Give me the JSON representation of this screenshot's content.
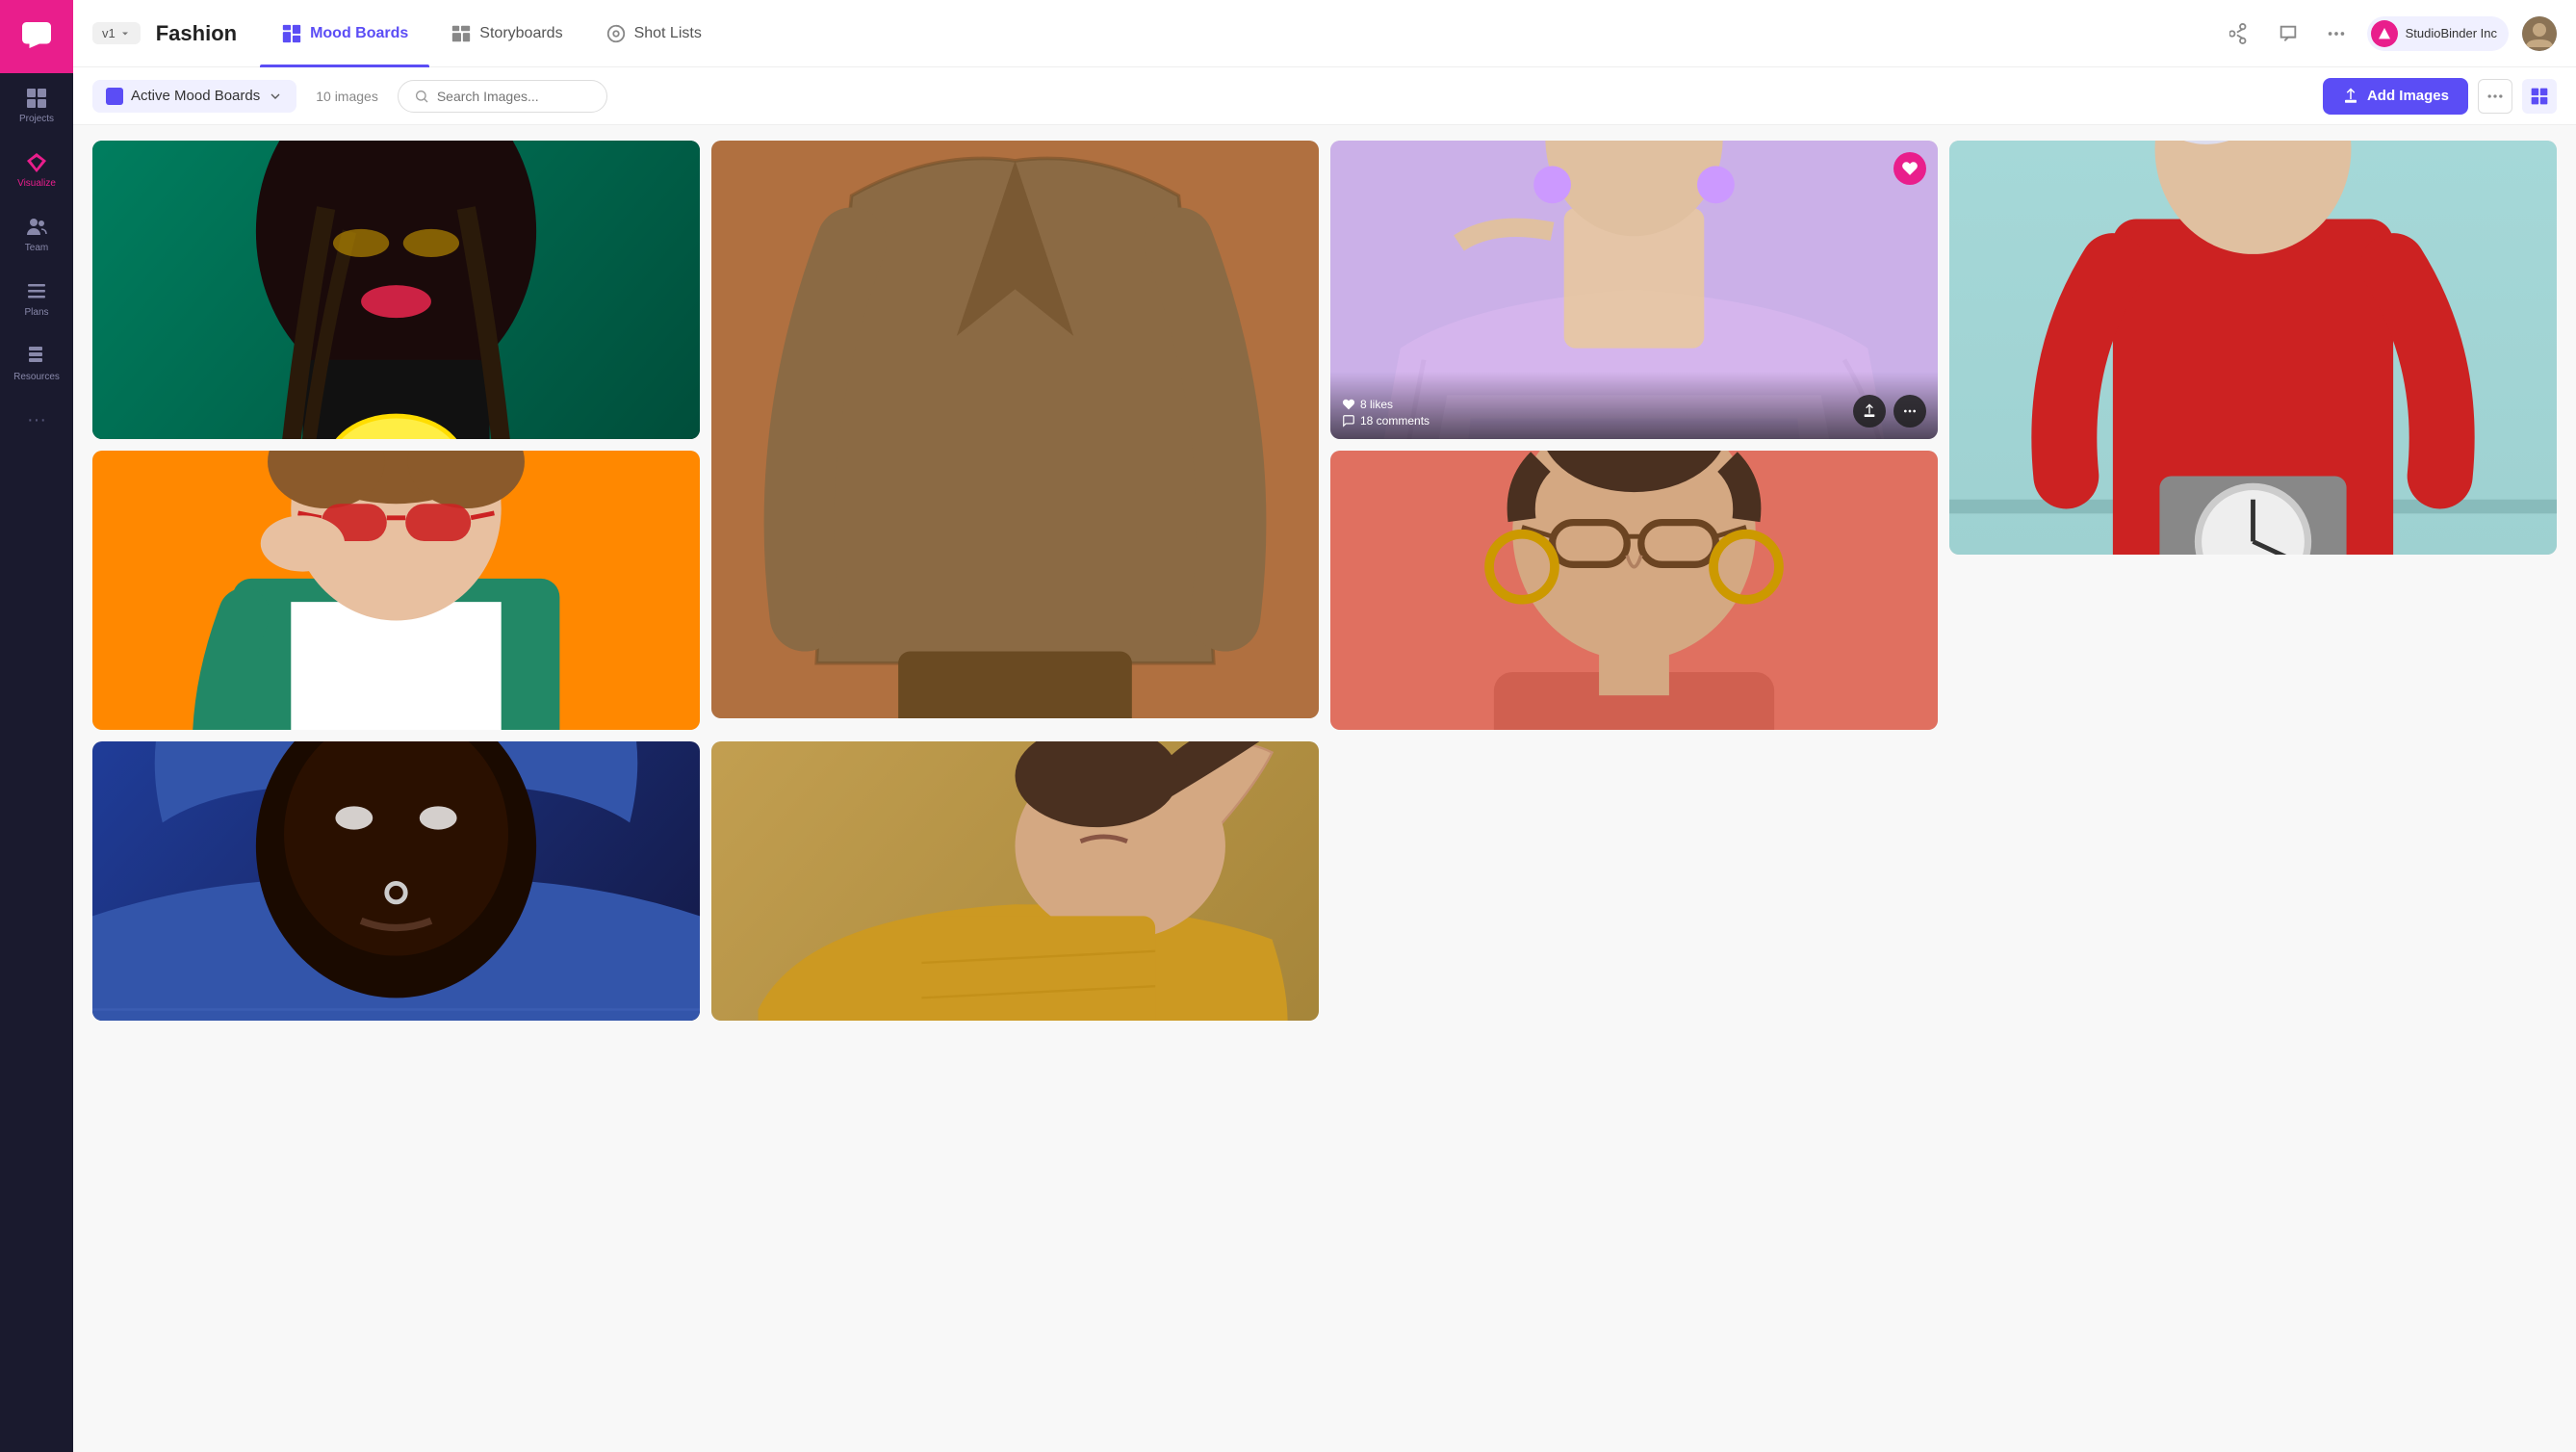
{
  "sidebar": {
    "logo_label": "StudioBinder Chat",
    "items": [
      {
        "id": "projects",
        "label": "Projects",
        "icon": "grid"
      },
      {
        "id": "visualize",
        "label": "Visualize",
        "icon": "diamond",
        "active": true
      },
      {
        "id": "team",
        "label": "Team",
        "icon": "people"
      },
      {
        "id": "plans",
        "label": "Plans",
        "icon": "bars"
      },
      {
        "id": "resources",
        "label": "Resources",
        "icon": "book"
      }
    ],
    "more_label": "..."
  },
  "topnav": {
    "project_name": "Fashion",
    "version": "v1",
    "tabs": [
      {
        "id": "mood-boards",
        "label": "Mood Boards",
        "active": true
      },
      {
        "id": "storyboards",
        "label": "Storyboards",
        "active": false
      },
      {
        "id": "shot-lists",
        "label": "Shot Lists",
        "active": false
      }
    ],
    "user_name": "StudioBinder Inc"
  },
  "toolbar": {
    "board_selector_label": "Active Mood Boards",
    "image_count": "10 images",
    "search_placeholder": "Search Images...",
    "add_images_label": "Add Images"
  },
  "gallery": {
    "images": [
      {
        "id": "img1",
        "col": 1,
        "row": 1,
        "description": "Black woman with gold makeup and yellow lemon, teal background",
        "likes": 0,
        "comments": 0,
        "liked": false,
        "has_overlay": false
      },
      {
        "id": "img2",
        "col": 2,
        "row": 1,
        "description": "Asian woman in plaid coat, brown background, tall",
        "likes": 0,
        "comments": 0,
        "liked": false,
        "has_overlay": false
      },
      {
        "id": "img3",
        "col": 3,
        "row": 1,
        "description": "Woman in lavender tulle dress, purple hair",
        "likes": 8,
        "comments": 18,
        "liked": true,
        "has_overlay": true
      },
      {
        "id": "img4",
        "col": 4,
        "row": 1,
        "description": "Woman in red jumpsuit with VR headset and flowers, teal background",
        "likes": 0,
        "comments": 0,
        "liked": false,
        "has_overlay": false
      },
      {
        "id": "img5",
        "col": 1,
        "row": 2,
        "description": "Woman with red sunglasses, teal outfit, orange background",
        "likes": 0,
        "comments": 0,
        "liked": false,
        "has_overlay": false
      },
      {
        "id": "img6",
        "col": 2,
        "row": 2,
        "description": "Woman with sunglasses, gold earrings, pink background",
        "likes": 0,
        "comments": 0,
        "liked": false,
        "has_overlay": false
      },
      {
        "id": "img7",
        "col": 3,
        "row": 2,
        "description": "Man in blue knit hoodie, close up face, dark background",
        "likes": 0,
        "comments": 0,
        "liked": false,
        "has_overlay": false
      },
      {
        "id": "img8",
        "col": 4,
        "row": 2,
        "description": "Woman lying down in yellow outfit, warm background",
        "likes": 0,
        "comments": 0,
        "liked": false,
        "has_overlay": false
      }
    ],
    "likes_label": "likes",
    "comments_label": "comments"
  }
}
